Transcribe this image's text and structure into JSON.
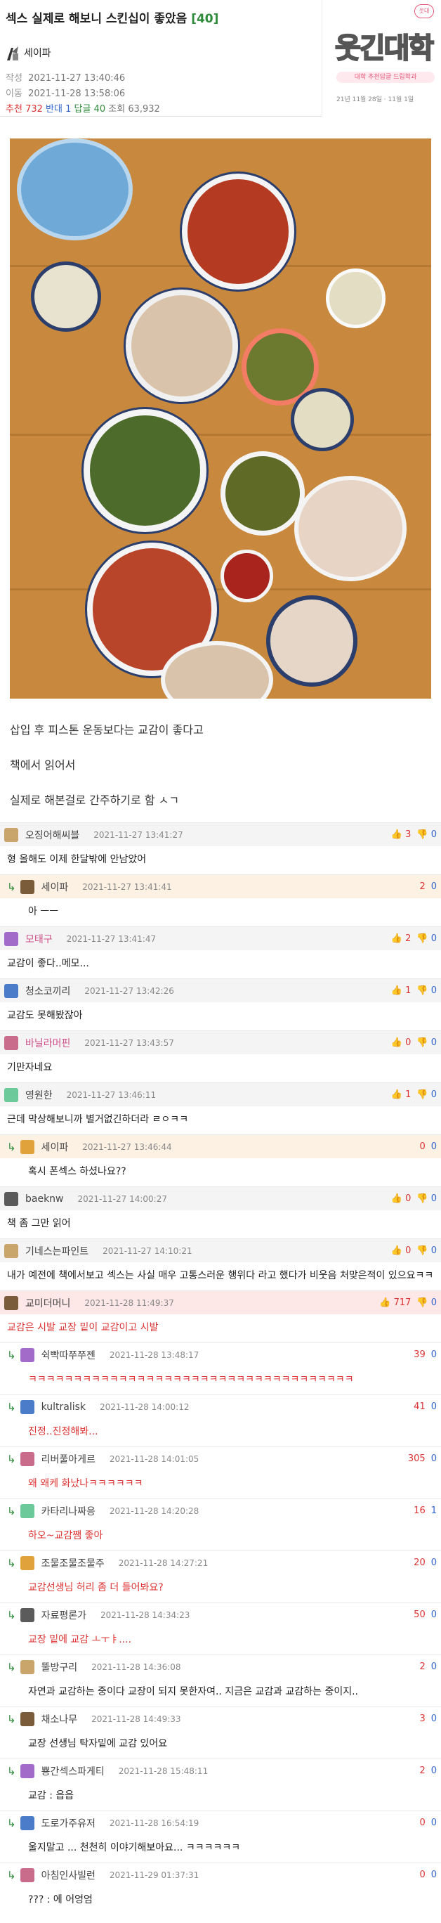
{
  "post": {
    "title": "섹스 실제로 해보니 스킨십이 좋았음",
    "comment_count_label": "[40]",
    "author": "세이파",
    "created_label": "작성",
    "created": "2021-11-27 13:40:46",
    "moved_label": "이동",
    "moved": "2021-11-28 13:58:06",
    "rec_label": "추천",
    "rec": "732",
    "down_label": "반대",
    "down": "1",
    "comments_label": "답글",
    "comments": "40",
    "views_label": "조회",
    "views": "63,932"
  },
  "logo": {
    "brand": "웃긴대학",
    "badge": "웃대",
    "sub": "대학 추천답글 드립학과",
    "small": "21년 11월 28일 · 11월 1일"
  },
  "body": {
    "line1": "삽입 후 피스톤 운동보다는 교감이 좋다고",
    "line2": "책에서 읽어서",
    "line3": "실제로 해본걸로 간주하기로 함 ㅅㄱ"
  },
  "comments": [
    {
      "type": "normal",
      "nick": "오징어해씨블",
      "time": "2021-11-27 13:41:27",
      "up": "3",
      "down": "0",
      "text": "형 올해도 이제 한달밖에 안남았어"
    },
    {
      "type": "reply",
      "nick": "세이파",
      "time": "2021-11-27 13:41:41",
      "up": "2",
      "down": "0",
      "text": "아 ㅡㅡ"
    },
    {
      "type": "normal",
      "nick": "모태구",
      "time": "2021-11-27 13:41:47",
      "up": "2",
      "down": "0",
      "text": "교감이 좋다..메모...",
      "nickStyle": "pink"
    },
    {
      "type": "normal",
      "nick": "청소코끼리",
      "time": "2021-11-27 13:42:26",
      "up": "1",
      "down": "0",
      "text": "교감도 못해봤잖아"
    },
    {
      "type": "normal",
      "nick": "바닐라머핀",
      "time": "2021-11-27 13:43:57",
      "up": "0",
      "down": "0",
      "text": "기만자네요",
      "nickStyle": "pink"
    },
    {
      "type": "normal",
      "nick": "영원한",
      "time": "2021-11-27 13:46:11",
      "up": "1",
      "down": "0",
      "text": "근데 막상해보니까 별거없긴하더라 ㄹㅇㅋㅋ"
    },
    {
      "type": "reply",
      "nick": "세이파",
      "time": "2021-11-27 13:46:44",
      "up": "0",
      "down": "0",
      "text": "혹시 폰섹스 하셨나요??"
    },
    {
      "type": "normal",
      "nick": "baeknw",
      "time": "2021-11-27 14:00:27",
      "up": "0",
      "down": "0",
      "text": "책 좀 그만 읽어"
    },
    {
      "type": "normal",
      "nick": "기네스는파인트",
      "time": "2021-11-27 14:10:21",
      "up": "0",
      "down": "0",
      "text": "내가 예전에 책에서보고 섹스는 사실 매우 고통스러운 행위다 라고 했다가 비웃음 처맞은적이 있으요ㅋㅋ"
    },
    {
      "type": "best",
      "nick": "교미더머니",
      "time": "2021-11-28 11:49:37",
      "up": "717",
      "down": "0",
      "text": "교감은 시발 교장 밑이 교감이고 시발"
    },
    {
      "type": "sub",
      "nick": "쉭빡따쭈쭈젠",
      "time": "2021-11-28 13:48:17",
      "up": "39",
      "down": "0",
      "text": "ㅋㅋㅋㅋㅋㅋㅋㅋㅋㅋㅋㅋㅋㅋㅋㅋㅋㅋㅋㅋㅋㅋㅋㅋㅋㅋㅋㅋㅋㅋㅋㅋㅋㅋㅋㅋ",
      "red": true
    },
    {
      "type": "sub",
      "nick": "kultralisk",
      "time": "2021-11-28 14:00:12",
      "up": "41",
      "down": "0",
      "text": "진정..진정해봐...",
      "red": true
    },
    {
      "type": "sub",
      "nick": "리버풀아게르",
      "time": "2021-11-28 14:01:05",
      "up": "305",
      "down": "0",
      "text": "왜 왜케 화났나ㅋㅋㅋㅋㅋㅋ",
      "red": true
    },
    {
      "type": "sub",
      "nick": "카타리나짜응",
      "time": "2021-11-28 14:20:28",
      "up": "16",
      "down": "1",
      "text": "하오~교감쨈 좋아",
      "red": true
    },
    {
      "type": "sub",
      "nick": "조물조물조물주",
      "time": "2021-11-28 14:27:21",
      "up": "20",
      "down": "0",
      "text": "교감선생님 허리 좀 더 들어봐요?",
      "red": true
    },
    {
      "type": "sub",
      "nick": "자료평론가",
      "time": "2021-11-28 14:34:23",
      "up": "50",
      "down": "0",
      "text": "교장 밑에 교감 ㅗㅜㅑ....",
      "red": true
    },
    {
      "type": "sub",
      "nick": "뚤방구리",
      "time": "2021-11-28 14:36:08",
      "up": "2",
      "down": "0",
      "text": "자연과 교감하는 중이다 교장이 되지 못한자여.. 지금은 교감과 교감하는 중이지.."
    },
    {
      "type": "sub",
      "nick": "채소나무",
      "time": "2021-11-28 14:49:33",
      "up": "3",
      "down": "0",
      "text": "교장 선생님 탁자밑에 교감 있어요"
    },
    {
      "type": "sub",
      "nick": "뿅간섹스파게티",
      "time": "2021-11-28 15:48:11",
      "up": "2",
      "down": "0",
      "text": "교감 : 읍읍"
    },
    {
      "type": "sub",
      "nick": "도로가주유저",
      "time": "2021-11-28 16:54:19",
      "up": "0",
      "down": "0",
      "text": "울지말고 ... 천천히 이야기해보아요... ㅋㅋㅋㅋㅋㅋ"
    },
    {
      "type": "sub",
      "nick": "아침인사빌런",
      "time": "2021-11-29 01:37:31",
      "up": "0",
      "down": "0",
      "text": "??? : 에 어엉엄"
    }
  ],
  "colors": {
    "green": "#2e8b3c",
    "red": "#d33",
    "blue": "#36c",
    "wood": "#c8893e"
  }
}
